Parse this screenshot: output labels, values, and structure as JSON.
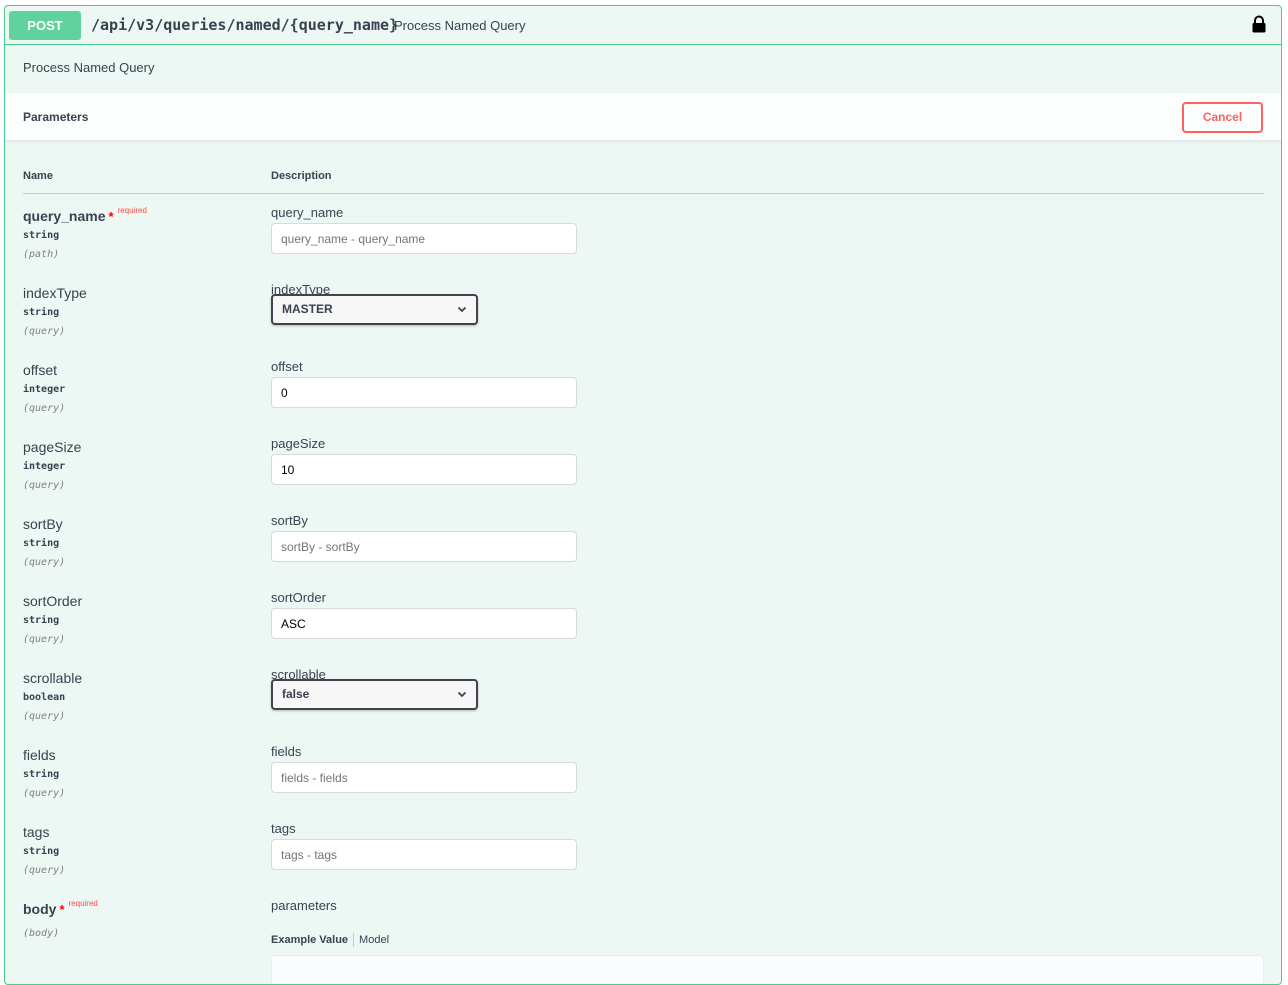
{
  "operation": {
    "method": "POST",
    "path": "/api/v3/queries/named/{query_name}",
    "summary": "Process Named Query",
    "description": "Process Named Query"
  },
  "parameters_section": {
    "title": "Parameters",
    "cancel_label": "Cancel",
    "col_name": "Name",
    "col_description": "Description",
    "required_label": "required"
  },
  "params": [
    {
      "name": "query_name",
      "type": "string",
      "in": "(path)",
      "label": "query_name",
      "placeholder": "query_name - query_name",
      "value": "",
      "required": true,
      "kind": "text"
    },
    {
      "name": "indexType",
      "type": "string",
      "in": "(query)",
      "label": "indexType",
      "value": "MASTER",
      "kind": "select"
    },
    {
      "name": "offset",
      "type": "integer",
      "in": "(query)",
      "label": "offset",
      "placeholder": "",
      "value": "0",
      "kind": "text"
    },
    {
      "name": "pageSize",
      "type": "integer",
      "in": "(query)",
      "label": "pageSize",
      "placeholder": "",
      "value": "10",
      "kind": "text"
    },
    {
      "name": "sortBy",
      "type": "string",
      "in": "(query)",
      "label": "sortBy",
      "placeholder": "sortBy - sortBy",
      "value": "",
      "kind": "text"
    },
    {
      "name": "sortOrder",
      "type": "string",
      "in": "(query)",
      "label": "sortOrder",
      "placeholder": "",
      "value": "ASC",
      "kind": "text"
    },
    {
      "name": "scrollable",
      "type": "boolean",
      "in": "(query)",
      "label": "scrollable",
      "value": "false",
      "kind": "select"
    },
    {
      "name": "fields",
      "type": "string",
      "in": "(query)",
      "label": "fields",
      "placeholder": "fields - fields",
      "value": "",
      "kind": "text"
    },
    {
      "name": "tags",
      "type": "string",
      "in": "(query)",
      "label": "tags",
      "placeholder": "tags - tags",
      "value": "",
      "kind": "text"
    }
  ],
  "body_param": {
    "name": "body",
    "in": "(body)",
    "label": "parameters",
    "tab_example": "Example Value",
    "tab_model": "Model"
  },
  "colors": {
    "post_green": "#49cc90",
    "post_bg": "#edf7f3",
    "cancel_red": "#ff6060"
  },
  "icons": {
    "lock": "lock-icon",
    "chevron": "chevron-down-icon"
  }
}
